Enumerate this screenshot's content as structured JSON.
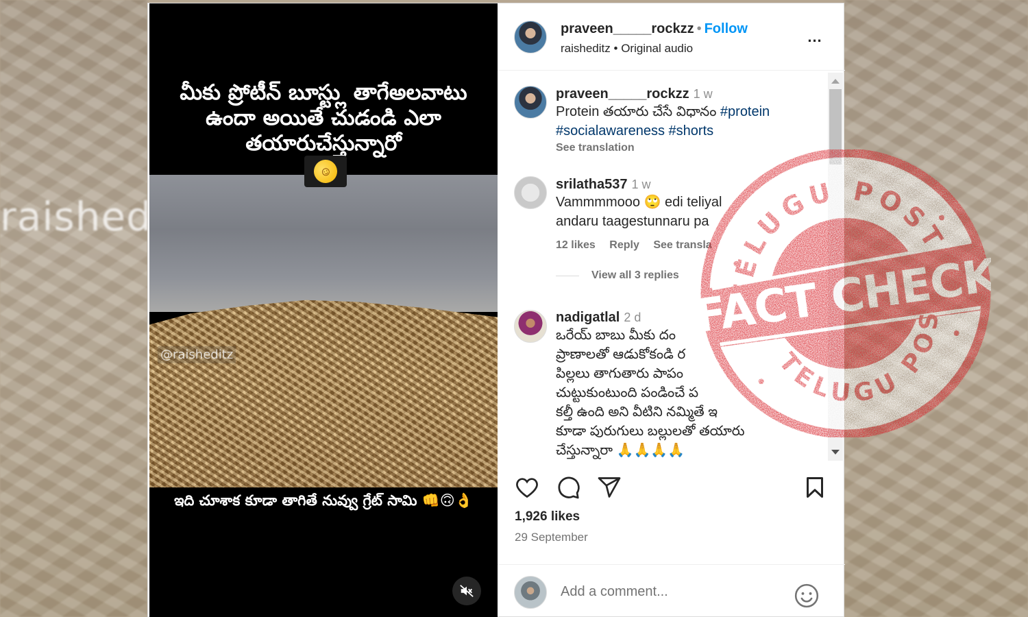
{
  "background": {
    "watermark": "raished"
  },
  "video": {
    "top_overlay": "మీకు ప్రోటీన్ బూస్ట్లు తాగేఅలవాటు ఉందా అయితే చుడండి ఎలా తయారుచేస్తున్నారో",
    "top_emoji": "rolling-on-floor-laughing-emoji",
    "handle_watermark": "@raisheditz",
    "bottom_overlay": "ఇది చూశాక కూడా తాగితే నువ్వు గ్రేట్ సామి 👊🙃👌",
    "mute_icon": "speaker-muted-icon"
  },
  "post": {
    "username": "praveen_____rockzz",
    "separator": "•",
    "follow_label": "Follow",
    "audio_user": "raisheditz",
    "audio_label": "Original audio",
    "more_icon": "..."
  },
  "caption": {
    "username": "praveen_____rockzz",
    "time": "1 w",
    "text_prefix": "Protein తయారు చేసే విధానం",
    "hashtags": [
      "#protein",
      "#socialawareness",
      "#shorts"
    ],
    "see_translation": "See translation"
  },
  "comments": [
    {
      "username": "srilatha537",
      "time": "1 w",
      "line1": "Vammmmooo 🙄 edi teliyal",
      "line2": "andaru taagestunnaru pa",
      "likes": "12 likes",
      "reply": "Reply",
      "see_translation": "See transla",
      "view_replies": "View all 3 replies"
    },
    {
      "username": "nadigatlal",
      "time": "2 d",
      "lines": [
        "ఒరేయ్ బాబు మీకు దం",
        "ప్రాణాలతో ఆడుకోకండి ర",
        "పిల్లలు తాగుతారు పాపం",
        "చుట్టుకుంటుంది పండించే ప",
        "కల్తీ ఉంది అని వీటిని నమ్మితే ఇ",
        "కూడా పురుగులు బల్లులతో తయారు",
        "చేస్తున్నారా 🙏🙏🙏🙏"
      ]
    }
  ],
  "actions": {
    "likes": "1,926 likes",
    "date": "29 September",
    "comment_placeholder": "Add a comment..."
  },
  "stamp": {
    "top_text": "TELUGU POST",
    "main_text": "FACT CHECK",
    "bottom_text": "TELUGU POST",
    "color": "#d8232a"
  }
}
